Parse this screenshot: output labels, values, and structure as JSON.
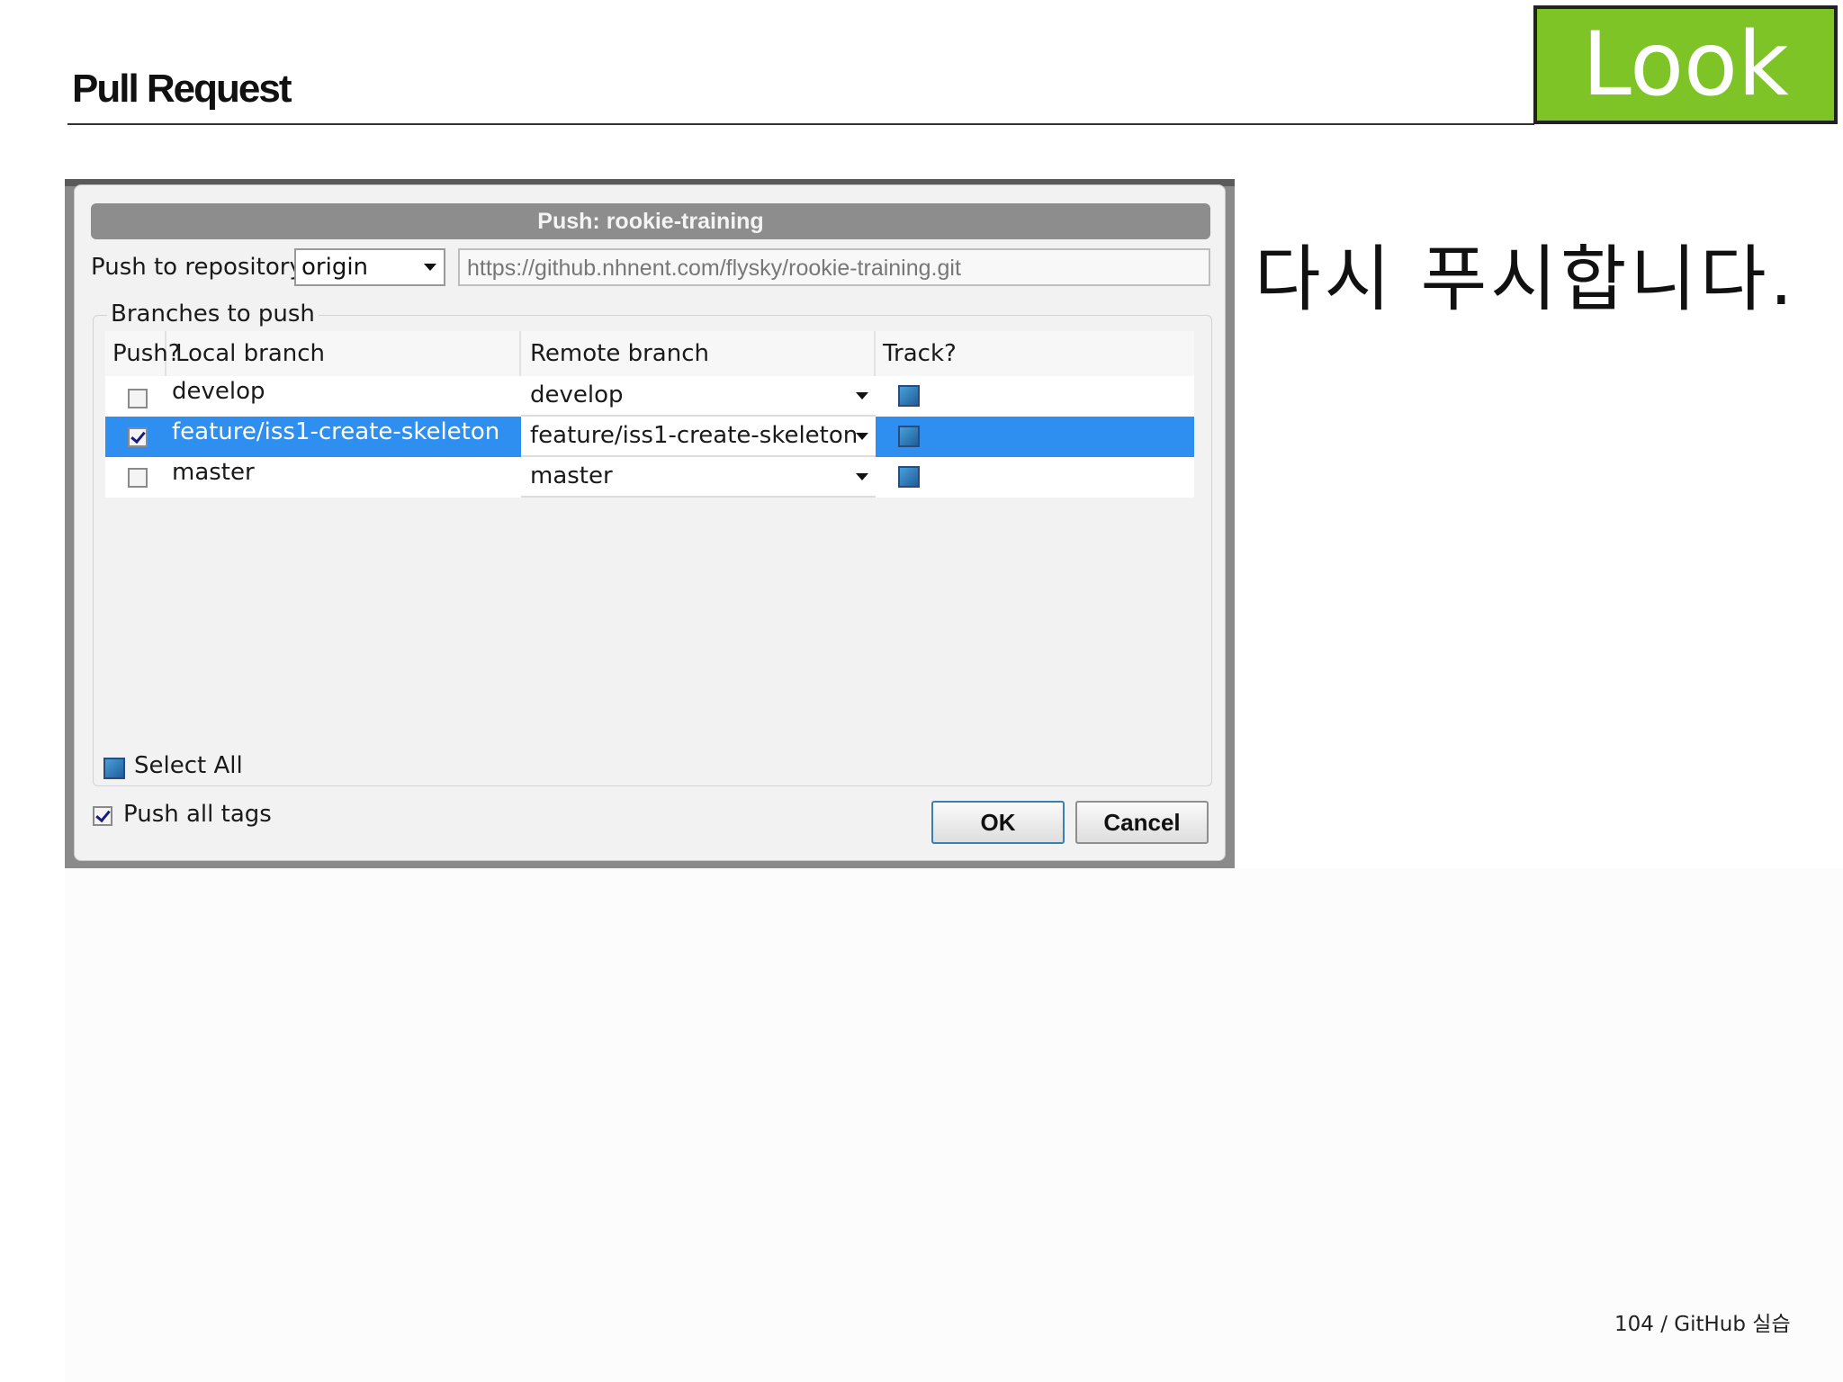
{
  "slide": {
    "title": "Pull Request",
    "badge": "Look",
    "instruction": "다시 푸시합니다.",
    "footer": "104 / GitHub 실습"
  },
  "dialog": {
    "title": "Push: rookie-training",
    "repo_label": "Push to repository:",
    "repo_selected": "origin",
    "repo_url": "https://github.nhnent.com/flysky/rookie-training.git",
    "group_label": "Branches to push",
    "columns": {
      "push": "Push?",
      "local": "Local branch",
      "remote": "Remote branch",
      "track": "Track?"
    },
    "rows": [
      {
        "push": false,
        "local": "develop",
        "remote": "develop",
        "track": true,
        "selected": false
      },
      {
        "push": true,
        "local": "feature/iss1-create-skeleton",
        "remote": "feature/iss1-create-skeleton",
        "track": true,
        "selected": true
      },
      {
        "push": false,
        "local": "master",
        "remote": "master",
        "track": true,
        "selected": false
      }
    ],
    "select_all_label": "Select All",
    "push_tags_label": "Push all tags",
    "push_tags_checked": true,
    "ok_label": "OK",
    "cancel_label": "Cancel"
  },
  "colors": {
    "badge": "#7ec427",
    "selection": "#2f8ff0"
  }
}
